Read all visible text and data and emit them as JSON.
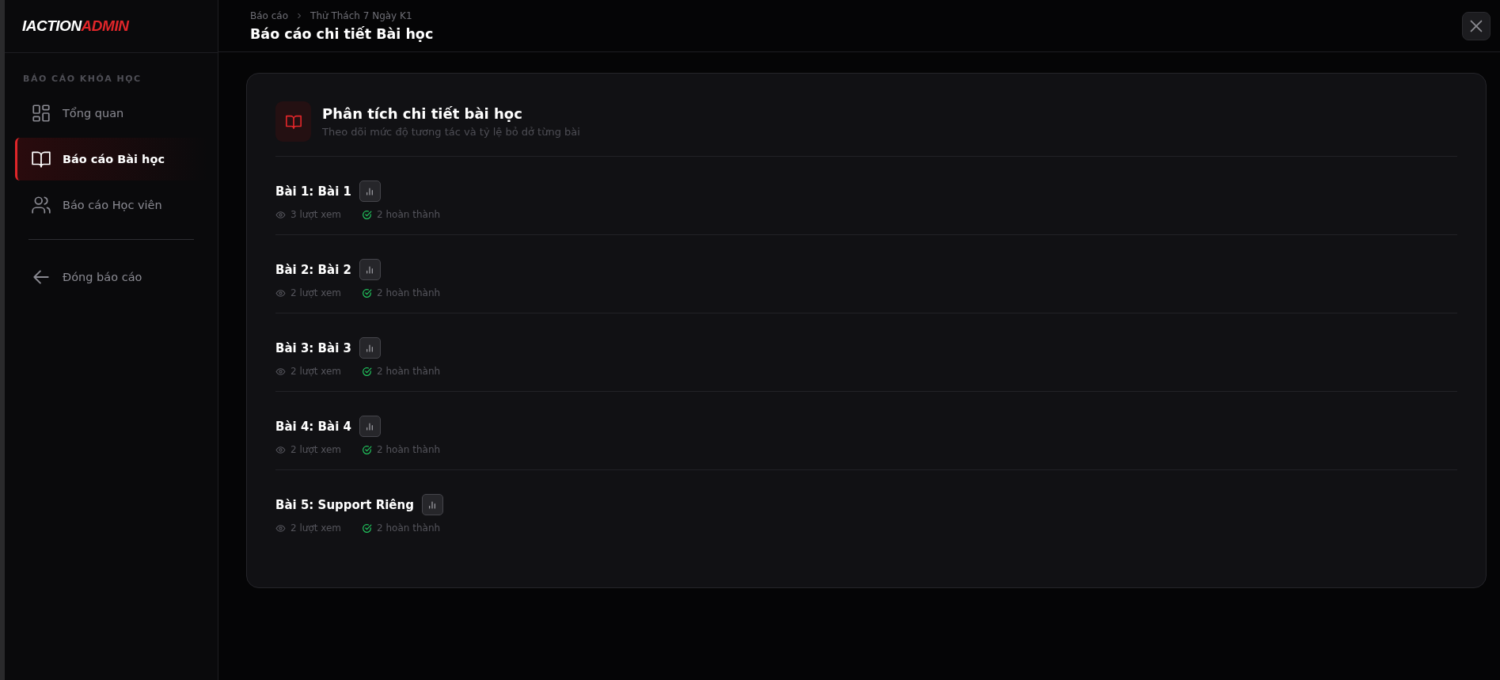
{
  "logo": [
    {
      "text": "IACTION",
      "kind": "plain"
    },
    {
      "text": "ADMIN",
      "kind": "accent"
    }
  ],
  "sidebar": {
    "section_title": "BÁO CÁO KHÓA HỌC",
    "items": [
      {
        "label": "Tổng quan",
        "selected": false
      },
      {
        "label": "Báo cáo Bài học",
        "selected": true
      },
      {
        "label": "Báo cáo Học viên",
        "selected": false
      }
    ],
    "close_link": {
      "label": "Đóng báo cáo"
    }
  },
  "header": {
    "breadcrumb": [
      "Báo cáo",
      "Thử Thách 7 Ngày K1"
    ],
    "title": "Báo cáo chi tiết Bài học"
  },
  "card": {
    "title": "Phân tích chi tiết bài học",
    "subtitle": "Theo dõi mức độ tương tác và tỷ lệ bỏ dở từng bài",
    "lessons": [
      {
        "title": "Bài 1: Bài 1",
        "views": "3 lượt xem",
        "completed": "2 hoàn thành"
      },
      {
        "title": "Bài 2: Bài 2",
        "views": "2 lượt xem",
        "completed": "2 hoàn thành"
      },
      {
        "title": "Bài 3: Bài 3",
        "views": "2 lượt xem",
        "completed": "2 hoàn thành"
      },
      {
        "title": "Bài 4: Bài 4",
        "views": "2 lượt xem",
        "completed": "2 hoàn thành"
      },
      {
        "title": "Bài 5: Support Riêng",
        "views": "2 lượt xem",
        "completed": "2 hoàn thành"
      }
    ]
  }
}
